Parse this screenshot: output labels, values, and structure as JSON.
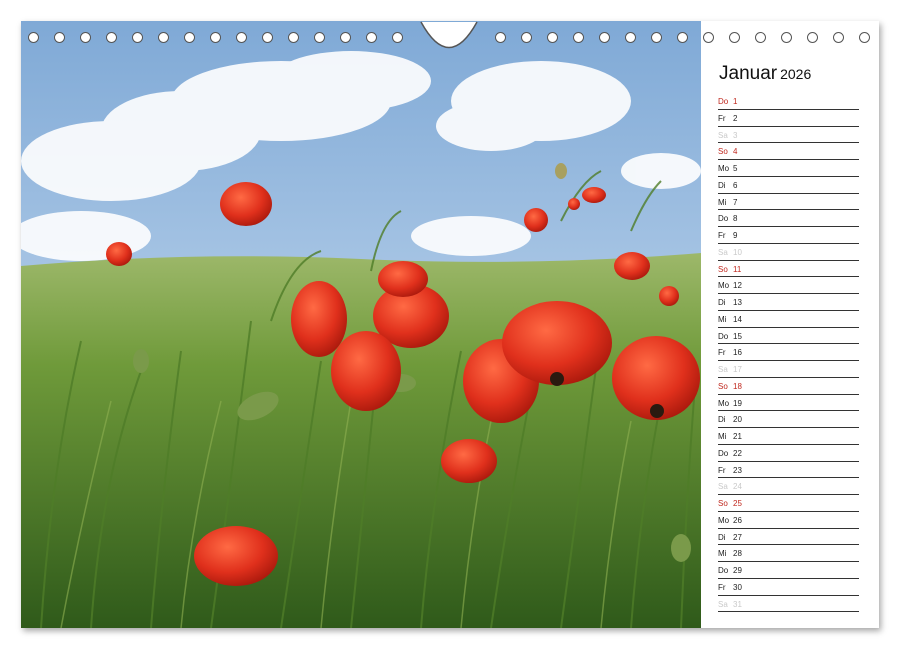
{
  "calendar": {
    "month": "Januar",
    "year": "2026",
    "days": [
      {
        "wd": "Do",
        "d": "1",
        "type": "hol"
      },
      {
        "wd": "Fr",
        "d": "2",
        "type": "work"
      },
      {
        "wd": "Sa",
        "d": "3",
        "type": "sat"
      },
      {
        "wd": "So",
        "d": "4",
        "type": "sun"
      },
      {
        "wd": "Mo",
        "d": "5",
        "type": "work"
      },
      {
        "wd": "Di",
        "d": "6",
        "type": "work"
      },
      {
        "wd": "Mi",
        "d": "7",
        "type": "work"
      },
      {
        "wd": "Do",
        "d": "8",
        "type": "work"
      },
      {
        "wd": "Fr",
        "d": "9",
        "type": "work"
      },
      {
        "wd": "Sa",
        "d": "10",
        "type": "sat"
      },
      {
        "wd": "So",
        "d": "11",
        "type": "sun"
      },
      {
        "wd": "Mo",
        "d": "12",
        "type": "work"
      },
      {
        "wd": "Di",
        "d": "13",
        "type": "work"
      },
      {
        "wd": "Mi",
        "d": "14",
        "type": "work"
      },
      {
        "wd": "Do",
        "d": "15",
        "type": "work"
      },
      {
        "wd": "Fr",
        "d": "16",
        "type": "work"
      },
      {
        "wd": "Sa",
        "d": "17",
        "type": "sat"
      },
      {
        "wd": "So",
        "d": "18",
        "type": "sun"
      },
      {
        "wd": "Mo",
        "d": "19",
        "type": "work"
      },
      {
        "wd": "Di",
        "d": "20",
        "type": "work"
      },
      {
        "wd": "Mi",
        "d": "21",
        "type": "work"
      },
      {
        "wd": "Do",
        "d": "22",
        "type": "work"
      },
      {
        "wd": "Fr",
        "d": "23",
        "type": "work"
      },
      {
        "wd": "Sa",
        "d": "24",
        "type": "sat"
      },
      {
        "wd": "So",
        "d": "25",
        "type": "sun"
      },
      {
        "wd": "Mo",
        "d": "26",
        "type": "work"
      },
      {
        "wd": "Di",
        "d": "27",
        "type": "work"
      },
      {
        "wd": "Mi",
        "d": "28",
        "type": "work"
      },
      {
        "wd": "Do",
        "d": "29",
        "type": "work"
      },
      {
        "wd": "Fr",
        "d": "30",
        "type": "work"
      },
      {
        "wd": "Sa",
        "d": "31",
        "type": "sat"
      }
    ]
  },
  "photo": {
    "subject": "poppy-field-icon",
    "colors": {
      "sky": "#8fb4d8",
      "grass": "#6f9a3a",
      "poppy": "#e0301c"
    }
  },
  "colors": {
    "sunday": "#c0281e",
    "saturday": "#c9c9c9",
    "text": "#222222"
  }
}
